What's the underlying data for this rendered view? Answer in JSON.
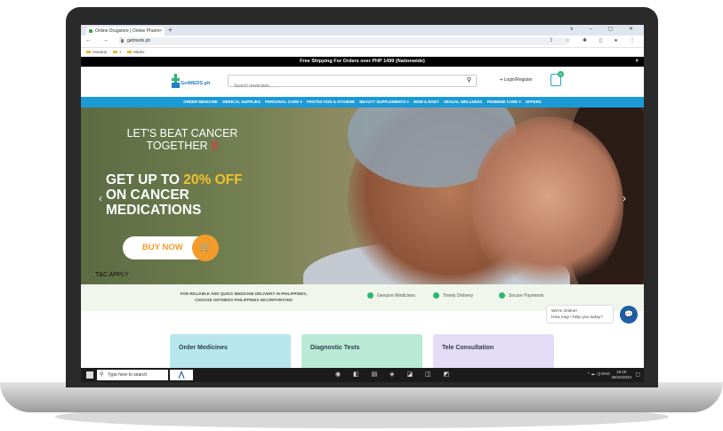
{
  "browser": {
    "tab_title": "Online Drugstore | Online Pharm",
    "tab_close": "×",
    "new_tab": "+",
    "window_controls": "∨ – ▢ ✕",
    "nav_buttons": "← → C",
    "url": "getmeds.ph",
    "toolbar_icons": "⇪ ☆ ✱ ▯ ● ⋮",
    "bookmarks": [
      "Aventus",
      "•",
      "Marks"
    ]
  },
  "site": {
    "promo_text": "Free Shipping For Orders over PHP 1499 (Nationwide)",
    "promo_close": "×",
    "logo_text": "GetMEDS.ph",
    "search_placeholder": "Search medicines...",
    "search_icon": "⚲",
    "login_label": "⇥ Login/Register",
    "cart_count": "0",
    "nav_items": [
      "ORDER MEDICINE",
      "MEDICAL SUPPLIES",
      "PERSONAL CARE ▾",
      "PROTECTION & HYGIENE",
      "BEAUTY SUPPLEMENTS ▾",
      "MOM & BABY",
      "SEXUAL WELLNESS",
      "FEMININE CARE ▾",
      "OFFERS"
    ],
    "hero": {
      "line1": "LET'S BEAT CANCER",
      "line2": "TOGETHER",
      "mark": "X",
      "offer_prefix": "GET UP TO",
      "offer_highlight": "20% OFF",
      "offer_line2": "ON CANCER",
      "offer_line3": "MEDICATIONS",
      "buy_label": "BUY NOW",
      "buy_icon": "🛒",
      "tnc": "T&C APPLY",
      "prev": "‹",
      "next": "›"
    },
    "trust": {
      "message": "FOR RELIABLE AND QUICK MEDICINE DELIVERY IN PHILIPPINES, CHOOSE GETMEDS PHILIPPINES INCORPORATED",
      "items": [
        "Genuine Medicines",
        "Timely Delivery",
        "Secure Payments"
      ]
    },
    "chat": {
      "line1": "We're Online!",
      "line2": "How may I help you today?",
      "icon": "💬"
    },
    "cards": [
      "Order Medicines",
      "Diagnostic Tests",
      "Tele Consultation"
    ]
  },
  "taskbar": {
    "search_placeholder": "Type here to search",
    "search_glyph": "⚲",
    "app_glyph": "⋀",
    "apps": "◉ ◧ ▤ ◈ ◪ ◫ ◩",
    "tray": "^ ☁ ◁) ENG",
    "time": "19:29",
    "date": "28/10/2023",
    "notif": "▢"
  }
}
